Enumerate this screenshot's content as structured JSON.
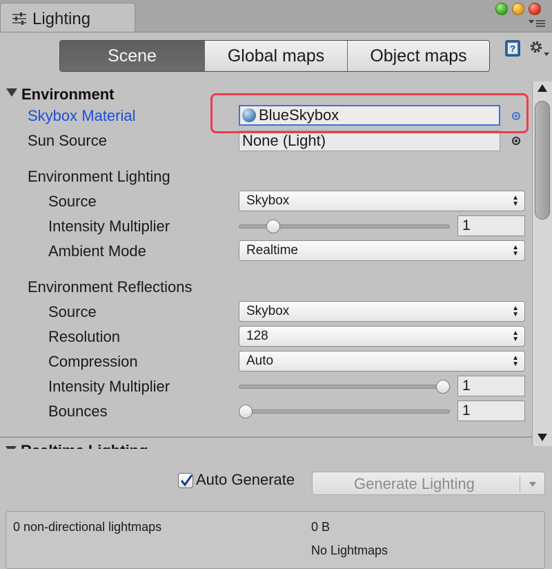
{
  "window": {
    "tab_title": "Lighting",
    "tab_icon": "sliders-icon",
    "controls": [
      "window-maximize-green",
      "window-minimize-yellow",
      "window-close-red"
    ],
    "menu_icon": "hamburger-menu-icon"
  },
  "toolbar": {
    "tabs": [
      {
        "label": "Scene",
        "active": true
      },
      {
        "label": "Global maps",
        "active": false
      },
      {
        "label": "Object maps",
        "active": false
      }
    ],
    "help_icon": "book-help-icon",
    "settings_icon": "gear-dropdown-icon"
  },
  "environment": {
    "title": "Environment",
    "skybox_material": {
      "label": "Skybox Material",
      "value": "BlueSkybox",
      "picker_icon": "object-picker-icon"
    },
    "sun_source": {
      "label": "Sun Source",
      "value": "None (Light)",
      "picker_icon": "object-picker-icon"
    },
    "lighting": {
      "title": "Environment Lighting",
      "source": {
        "label": "Source",
        "value": "Skybox"
      },
      "intensity": {
        "label": "Intensity Multiplier",
        "value": "1",
        "slider_fraction": 0.14
      },
      "ambient_mode": {
        "label": "Ambient Mode",
        "value": "Realtime"
      }
    },
    "reflections": {
      "title": "Environment Reflections",
      "source": {
        "label": "Source",
        "value": "Skybox"
      },
      "resolution": {
        "label": "Resolution",
        "value": "128"
      },
      "compression": {
        "label": "Compression",
        "value": "Auto"
      },
      "intensity": {
        "label": "Intensity Multiplier",
        "value": "1",
        "slider_fraction": 1.0
      },
      "bounces": {
        "label": "Bounces",
        "value": "1",
        "slider_fraction": 0.0
      }
    }
  },
  "realtime_lighting": {
    "title": "Realtime Lighting"
  },
  "footer": {
    "auto_generate": {
      "label": "Auto Generate",
      "checked": true
    },
    "generate_button": "Generate Lighting",
    "lightmaps_label": "0 non-directional lightmaps",
    "lightmaps_size": "0 B",
    "lightmaps_status": "No Lightmaps"
  },
  "colors": {
    "highlight": "#ee3b4a",
    "label_selected": "#1e4fd6",
    "focus_border": "#3d73d4",
    "panel_bg": "#c2c2c2"
  }
}
